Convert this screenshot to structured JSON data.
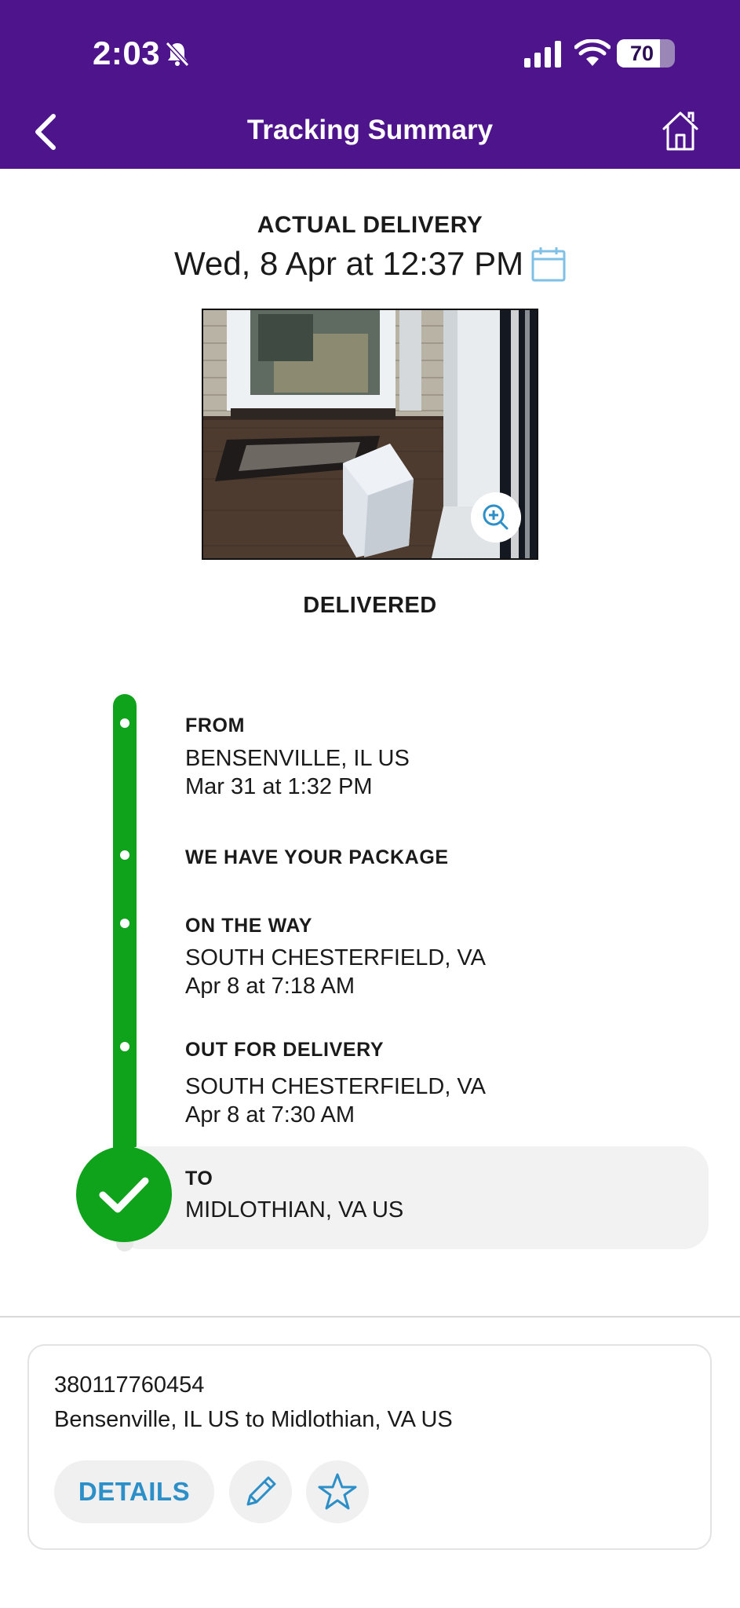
{
  "status_bar": {
    "time": "2:03",
    "battery": "70",
    "battery_level": 0.7,
    "icons": [
      "bell-slash-icon",
      "cellular-signal-icon",
      "wifi-icon",
      "battery-icon"
    ]
  },
  "header": {
    "title": "Tracking Summary",
    "back_icon": "chevron-left-icon",
    "home_icon": "home-icon",
    "bg_color": "#4d148c"
  },
  "delivery": {
    "label": "ACTUAL DELIVERY",
    "date": "Wed, 8 Apr at 12:37 PM",
    "calendar_icon": "calendar-icon",
    "photo_alt": "Package on porch near front door",
    "zoom_icon": "zoom-in-icon",
    "status": "DELIVERED"
  },
  "timeline": {
    "color": "#0fa31b",
    "events": [
      {
        "label": "FROM",
        "location": "BENSENVILLE, IL US",
        "time": "Mar 31 at 1:32 PM"
      },
      {
        "label": "WE HAVE YOUR PACKAGE"
      },
      {
        "label": "ON THE WAY",
        "location": "SOUTH CHESTERFIELD, VA",
        "time": "Apr 8 at 7:18 AM"
      },
      {
        "label": "OUT FOR DELIVERY",
        "location": "SOUTH CHESTERFIELD, VA",
        "time": "Apr 8 at 7:30 AM"
      }
    ],
    "destination": {
      "label": "TO",
      "location": "MIDLOTHIAN, VA  US",
      "icon": "checkmark-icon"
    }
  },
  "shipment_card": {
    "tracking_number": "380117760454",
    "route": "Bensenville, IL US to Midlothian, VA US",
    "details_label": "DETAILS",
    "edit_icon": "pencil-icon",
    "favorite_icon": "star-icon",
    "accent_color": "#2d8fc8"
  }
}
